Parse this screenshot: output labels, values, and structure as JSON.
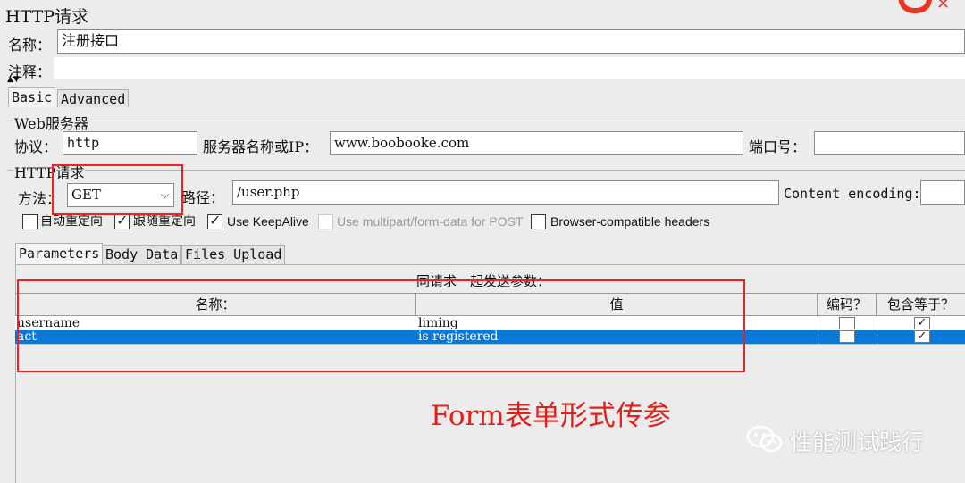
{
  "panel_title": "HTTP请求",
  "name_label": "名称：",
  "name_value": "注册接口",
  "comment_label": "注释：",
  "comment_value": "",
  "top_tabs": [
    {
      "label": "Basic",
      "active": true
    },
    {
      "label": "Advanced",
      "active": false
    }
  ],
  "web_server": {
    "group_title": "Web服务器",
    "protocol_label": "协议：",
    "protocol_value": "http",
    "server_label": "服务器名称或IP：",
    "server_value": "www.boobooke.com",
    "port_label": "端口号：",
    "port_value": ""
  },
  "http_request": {
    "group_title": "HTTP请求",
    "method_label": "方法：",
    "method_value": "GET",
    "path_label": "路径：",
    "path_value": "/user.php",
    "encoding_label": "Content encoding:",
    "encoding_value": ""
  },
  "options": [
    {
      "label": "自动重定向",
      "checked": false,
      "enabled": true
    },
    {
      "label": "跟随重定向",
      "checked": true,
      "enabled": true
    },
    {
      "label": "Use KeepAlive",
      "checked": true,
      "enabled": true
    },
    {
      "label": "Use multipart/form-data for POST",
      "checked": false,
      "enabled": false
    },
    {
      "label": "Browser-compatible headers",
      "checked": false,
      "enabled": true
    }
  ],
  "param_tabs": [
    {
      "label": "Parameters",
      "active": true
    },
    {
      "label": "Body Data",
      "active": false
    },
    {
      "label": "Files Upload",
      "active": false
    }
  ],
  "params_caption": "同请求一起发送参数：",
  "table": {
    "headers": [
      "名称：",
      "值",
      "编码？",
      "包含等于？"
    ],
    "rows": [
      {
        "name": "username",
        "value": "liming",
        "encode": false,
        "include_equals": true,
        "selected": false
      },
      {
        "name": "act",
        "value": "is registered",
        "encode": false,
        "include_equals": true,
        "selected": true
      }
    ]
  },
  "annotation_text": "Form表单形式传参",
  "watermark_text": "性能测试践行",
  "colors": {
    "highlight": "#ee2222",
    "selection": "#0a78d7",
    "annotation": "#e0201a"
  }
}
